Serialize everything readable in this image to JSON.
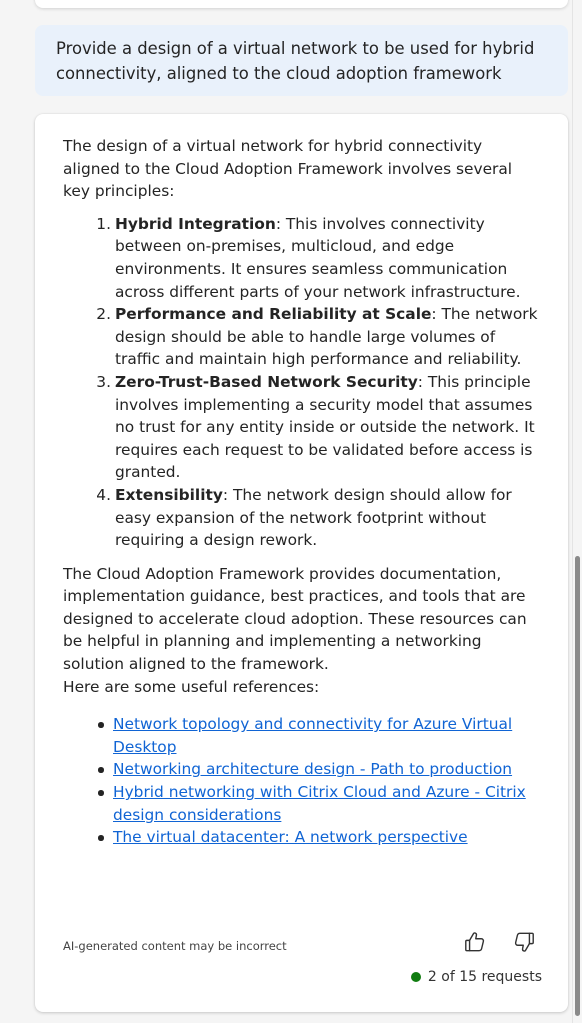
{
  "user_message": "Provide a design of a virtual network to be used for hybrid connectivity, aligned to the cloud adoption framework",
  "response": {
    "intro": "The design of a virtual network for hybrid connectivity aligned to the Cloud Adoption Framework involves several key principles:",
    "principles": [
      {
        "title": "Hybrid Integration",
        "text": ": This involves connectivity between on-premises, multicloud, and edge environments. It ensures seamless communication across different parts of your network infrastructure."
      },
      {
        "title": "Performance and Reliability at Scale",
        "text": ": The network design should be able to handle large volumes of traffic and maintain high performance and reliability."
      },
      {
        "title": "Zero-Trust-Based Network Security",
        "text": ": This principle involves implementing a security model that assumes no trust for any entity inside or outside the network. It requires each request to be validated before access is granted."
      },
      {
        "title": "Extensibility",
        "text": ": The network design should allow for easy expansion of the network footprint without requiring a design rework."
      }
    ],
    "closing": "The Cloud Adoption Framework provides documentation, implementation guidance, best practices, and tools that are designed to accelerate cloud adoption. These resources can be helpful in planning and implementing a networking solution aligned to the framework.",
    "refs_heading": "Here are some useful references:",
    "references": [
      "Network topology and connectivity for Azure Virtual Desktop",
      "Networking architecture design - Path to production",
      "Hybrid networking with Citrix Cloud and Azure - Citrix design considerations",
      "The virtual datacenter: A network perspective"
    ]
  },
  "footer": {
    "disclaimer": "AI-generated content may be incorrect",
    "thumbs_up_icon": "thumbs-up-icon",
    "thumbs_down_icon": "thumbs-down-icon",
    "requests_status": "2 of 15 requests",
    "status_color": "#107c10"
  },
  "colors": {
    "user_bubble": "#e9f1fb",
    "link": "#1064d4"
  }
}
